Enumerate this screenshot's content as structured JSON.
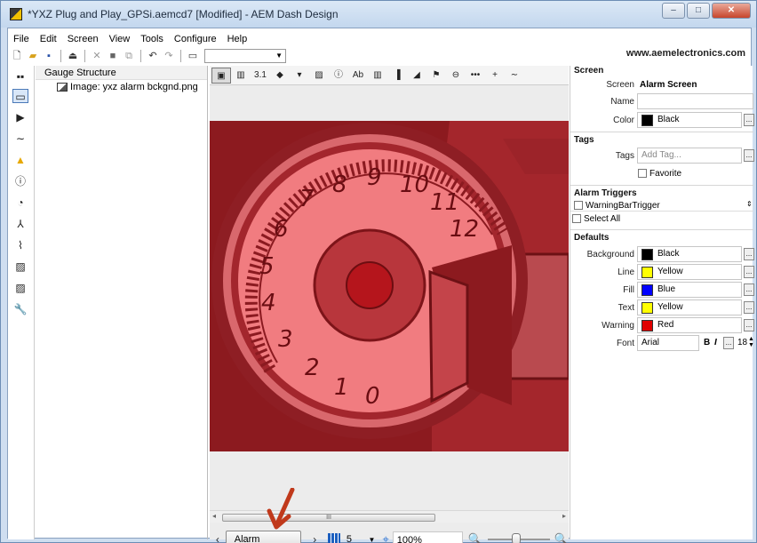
{
  "window": {
    "title": "*YXZ Plug and Play_GPSi.aemcd7 [Modified] - AEM Dash Design",
    "minimize": "–",
    "maximize": "□",
    "close": "✕"
  },
  "menu": [
    "File",
    "Edit",
    "Screen",
    "View",
    "Tools",
    "Configure",
    "Help"
  ],
  "website": "www.aemelectronics.com",
  "structure": {
    "header": "Gauge Structure",
    "item": "Image: yxz alarm bckgnd.png"
  },
  "canvas_tools": [
    "▣",
    "▥",
    "3.1",
    "◆",
    "▾",
    "▨",
    "ⓘ",
    "Ab",
    "▥",
    "▐",
    "◢",
    "⚑",
    "⊖",
    "•••",
    "+",
    "∼"
  ],
  "gauge": {
    "tick_labels": [
      "0",
      "1",
      "2",
      "3",
      "4",
      "5",
      "6",
      "7",
      "8",
      "9",
      "10",
      "11",
      "12"
    ],
    "background_color": "#8c1a1f"
  },
  "scrollbar": {
    "thumb_label": "III"
  },
  "bottom": {
    "prev": "‹",
    "screen_button": "Alarm Screen",
    "next": "›",
    "grid_value": "5",
    "zoom": "100%",
    "zoom_level": 0.45
  },
  "properties": {
    "screen_section": "Screen",
    "screen_label": "Screen",
    "screen_value": "Alarm Screen",
    "name_label": "Name",
    "name_value": "",
    "color_label": "Color",
    "color_value": "Black",
    "tags_section": "Tags",
    "tags_label": "Tags",
    "tags_placeholder": "Add Tag...",
    "favorite_label": "Favorite",
    "alarm_section": "Alarm Triggers",
    "alarm_item": "WarningBarTrigger",
    "select_all": "Select All",
    "defaults_section": "Defaults",
    "background_label": "Background",
    "background_value": "Black",
    "line_label": "Line",
    "line_value": "Yellow",
    "fill_label": "Fill",
    "fill_value": "Blue",
    "text_label": "Text",
    "text_value": "Yellow",
    "warning_label": "Warning",
    "warning_value": "Red",
    "font_label": "Font",
    "font_value": "Arial",
    "bold": "B",
    "italic": "I",
    "font_size": "18",
    "ellipsis": "..."
  },
  "colors": {
    "black": "#000000",
    "yellow": "#ffff00",
    "blue": "#0000ff",
    "red": "#e00000",
    "annotation_arrow": "#c0391b"
  }
}
